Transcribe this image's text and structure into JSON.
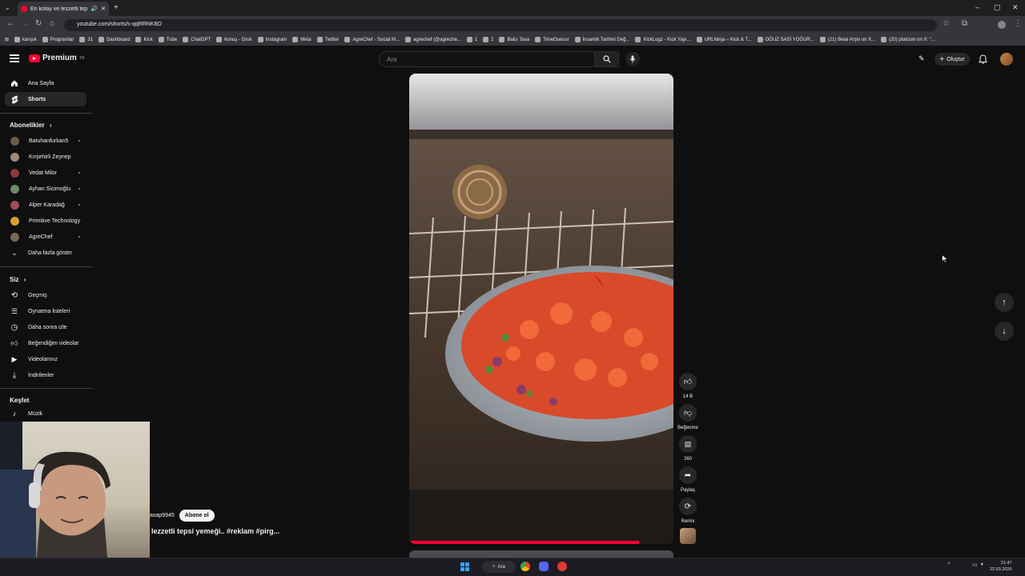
{
  "browser": {
    "tab_title": "En kolay ve lezzetli tepsi ye...",
    "url": "youtube.com/shorts/s-qqRRNK8O",
    "bookmarks": [
      "karışık",
      "Programlar",
      "31",
      "Dashboard",
      "Kick",
      "Tube",
      "ChatGPT",
      "konuş - Grok",
      "Instagram",
      "Meta",
      "Twitter",
      "AgreChef - Social M...",
      "agrechef (@agreche...",
      "1",
      "2",
      "Balcı Tava",
      "TimeGuessr",
      "İnsanlık Tarihini Değ...",
      "KickLogz - Kick Yayı...",
      "URLNinja – Kick & T...",
      "OĞUZ SASİ YOĞUR...",
      "(21) Belal Arşiv on X...",
      "(20) platcom on X: \"..."
    ]
  },
  "topbar": {
    "logo_text": "Premium",
    "logo_badge": "TR",
    "search_placeholder": "Ara",
    "create_label": "Oluştur"
  },
  "sidebar": {
    "main": [
      {
        "label": "Ana Sayfa",
        "icon": "home-icon"
      },
      {
        "label": "Shorts",
        "icon": "shorts-icon"
      }
    ],
    "subscriptions_header": "Abonelikler",
    "subscriptions": [
      {
        "label": "Batuhanfurkan5",
        "color": "#6b5b4b"
      },
      {
        "label": "Kırşehirli Zeynep",
        "color": "#a08a7a"
      },
      {
        "label": "Vedat Milor",
        "color": "#8a3a3a"
      },
      {
        "label": "Ayhan Sicimoğlu",
        "color": "#6a8a6a"
      },
      {
        "label": "Alper Karadağ",
        "color": "#a04a5a"
      },
      {
        "label": "Primitive Technology",
        "color": "#d8a030"
      },
      {
        "label": "AgreChef",
        "color": "#7a6a5a"
      }
    ],
    "show_more": "Daha fazla göster",
    "you_header": "Siz",
    "you_items": [
      {
        "label": "Geçmiş",
        "icon": "history-icon"
      },
      {
        "label": "Oynatma listeleri",
        "icon": "playlists-icon"
      },
      {
        "label": "Daha sonra izle",
        "icon": "watch-later-icon"
      },
      {
        "label": "Beğendiğim videolar",
        "icon": "liked-icon"
      },
      {
        "label": "Videolarınız",
        "icon": "your-videos-icon"
      },
      {
        "label": "İndirilenler",
        "icon": "downloads-icon"
      }
    ],
    "explore_header": "Keşfet",
    "explore_items": [
      {
        "label": "Müzik",
        "icon": "music-icon"
      }
    ]
  },
  "short": {
    "channel": "asap9945",
    "subscribe_label": "Abone ol",
    "title": "lezzetli tepsi yemeği.. #reklam #pirg...",
    "progress": 0.87
  },
  "actions": {
    "likes": "14 B",
    "dislike_label": "Beğenme",
    "comments": "260",
    "share_label": "Paylaş",
    "remix_label": "Remix"
  },
  "taskbar": {
    "search_label": "Ara",
    "time": "21:47",
    "date": "22.03.2026"
  }
}
